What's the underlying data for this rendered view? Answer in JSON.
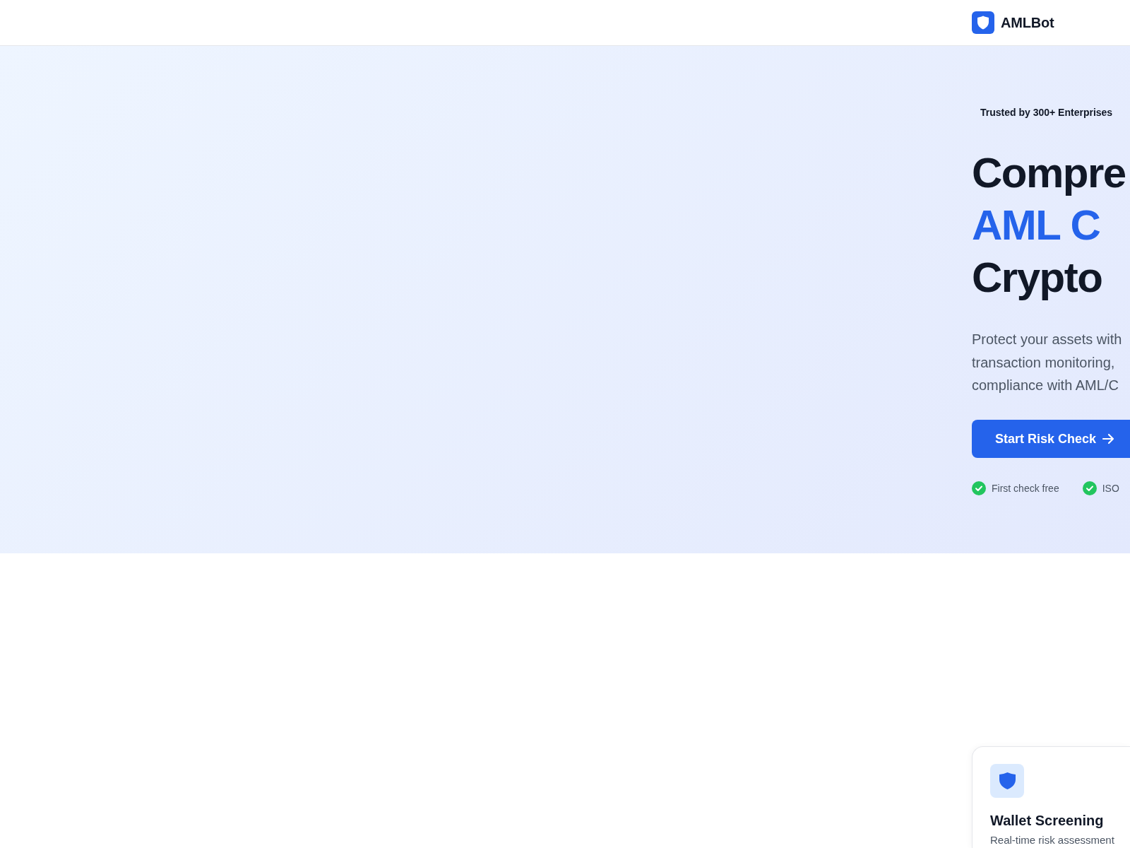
{
  "header": {
    "brand": "AMLBot"
  },
  "hero": {
    "badge": "Trusted by 300+ Enterprises",
    "heading": [
      {
        "text": "Compre",
        "accent": false
      },
      {
        "text": "AML C",
        "accent": true
      },
      {
        "text": "Crypto",
        "accent": false
      }
    ],
    "description": [
      "Protect your assets with",
      "transaction monitoring,",
      "compliance with AML/C"
    ],
    "cta": {
      "label": "Start Risk Check"
    },
    "checks": [
      {
        "label": "First check free"
      },
      {
        "label": "ISO"
      }
    ]
  },
  "features": [
    {
      "title": "Wallet Screening",
      "description": "Real-time risk assessment"
    }
  ]
}
